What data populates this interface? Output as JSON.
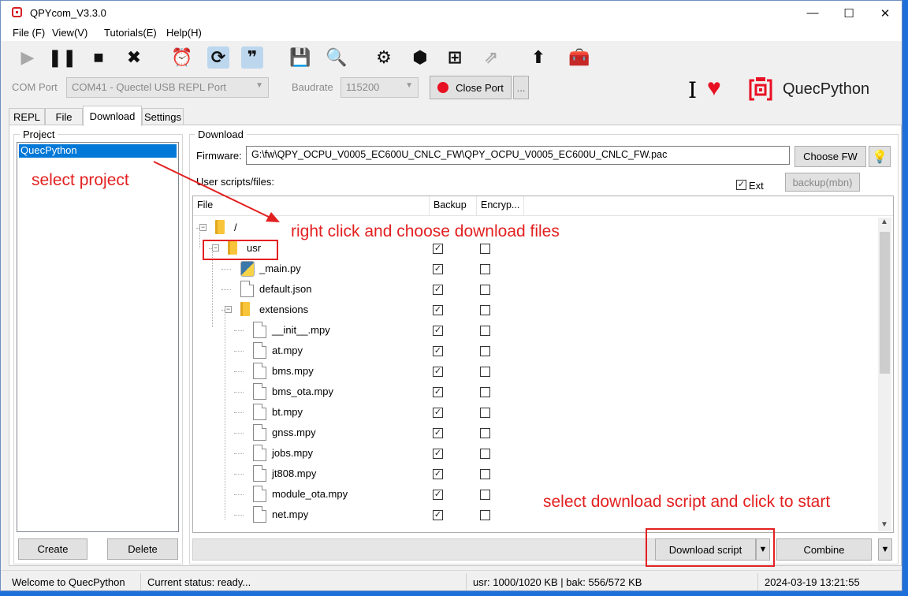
{
  "window": {
    "title": "QPYcom_V3.3.0",
    "minimize": "—",
    "maximize": "☐",
    "close": "✕"
  },
  "menu": [
    "File (F)",
    "View(V)",
    "Tutorials(E)",
    "Help(H)"
  ],
  "toolbar": [
    {
      "icon": "play-icon",
      "glyph": "▶",
      "state": "disabled"
    },
    {
      "icon": "pause-icon",
      "glyph": "❚❚",
      "state": "normal"
    },
    {
      "icon": "stop-icon",
      "glyph": "■",
      "state": "normal"
    },
    {
      "icon": "clear-icon",
      "glyph": "✖",
      "state": "normal"
    },
    {
      "icon": "timer-icon",
      "glyph": "⏰",
      "state": "normal"
    },
    {
      "icon": "repl-icon",
      "glyph": "⟳",
      "state": "active"
    },
    {
      "icon": "quote-icon",
      "glyph": "❞",
      "state": "active"
    },
    {
      "icon": "save-icon",
      "glyph": "💾",
      "state": "normal"
    },
    {
      "icon": "search-icon",
      "glyph": "🔍",
      "state": "normal"
    },
    {
      "icon": "gear-icon",
      "glyph": "⚙",
      "state": "normal"
    },
    {
      "icon": "cube-icon",
      "glyph": "⬢",
      "state": "normal"
    },
    {
      "icon": "add-icon",
      "glyph": "⊞",
      "state": "normal"
    },
    {
      "icon": "export-icon",
      "glyph": "⇗",
      "state": "disabled"
    },
    {
      "icon": "upload-icon",
      "glyph": "⬆",
      "state": "normal"
    },
    {
      "icon": "toolbox-icon",
      "glyph": "🧰",
      "state": "normal"
    }
  ],
  "com": {
    "label": "COM Port",
    "value": "COM41 - Quectel USB REPL Port",
    "baud_label": "Baudrate",
    "baud_value": "115200",
    "close_port": "Close Port",
    "more": "..."
  },
  "brand": {
    "name": "QuecPython",
    "cursor": "I",
    "heart": "♥"
  },
  "tabs": [
    "REPL",
    "File",
    "Download",
    "Settings"
  ],
  "project": {
    "title": "Project",
    "items": [
      "QuecPython"
    ],
    "create": "Create",
    "delete": "Delete"
  },
  "download": {
    "title": "Download",
    "firmware_label": "Firmware:",
    "firmware_path": "G:\\fw\\QPY_OCPU_V0005_EC600U_CNLC_FW\\QPY_OCPU_V0005_EC600U_CNLC_FW.pac",
    "choose_fw": "Choose FW",
    "user_scripts": "User scripts/files:",
    "ext_label": "Ext",
    "backup_btn": "backup(mbn)",
    "columns": [
      "File",
      "Backup",
      "Encryp..."
    ],
    "rows": [
      {
        "name": "/",
        "type": "folder",
        "level": 0,
        "backup": false,
        "encrypt": false,
        "checks": false
      },
      {
        "name": "usr",
        "type": "folder",
        "level": 1,
        "backup": true,
        "encrypt": false,
        "checks": true
      },
      {
        "name": "_main.py",
        "type": "py",
        "level": 2,
        "backup": true,
        "encrypt": false,
        "checks": true
      },
      {
        "name": "default.json",
        "type": "file",
        "level": 2,
        "backup": true,
        "encrypt": false,
        "checks": true
      },
      {
        "name": "extensions",
        "type": "folder",
        "level": 2,
        "backup": true,
        "encrypt": false,
        "checks": true
      },
      {
        "name": "__init__.mpy",
        "type": "file",
        "level": 3,
        "backup": true,
        "encrypt": false,
        "checks": true
      },
      {
        "name": "at.mpy",
        "type": "file",
        "level": 3,
        "backup": true,
        "encrypt": false,
        "checks": true
      },
      {
        "name": "bms.mpy",
        "type": "file",
        "level": 3,
        "backup": true,
        "encrypt": false,
        "checks": true
      },
      {
        "name": "bms_ota.mpy",
        "type": "file",
        "level": 3,
        "backup": true,
        "encrypt": false,
        "checks": true
      },
      {
        "name": "bt.mpy",
        "type": "file",
        "level": 3,
        "backup": true,
        "encrypt": false,
        "checks": true
      },
      {
        "name": "gnss.mpy",
        "type": "file",
        "level": 3,
        "backup": true,
        "encrypt": false,
        "checks": true
      },
      {
        "name": "jobs.mpy",
        "type": "file",
        "level": 3,
        "backup": true,
        "encrypt": false,
        "checks": true
      },
      {
        "name": "jt808.mpy",
        "type": "file",
        "level": 3,
        "backup": true,
        "encrypt": false,
        "checks": true
      },
      {
        "name": "module_ota.mpy",
        "type": "file",
        "level": 3,
        "backup": true,
        "encrypt": false,
        "checks": true
      },
      {
        "name": "net.mpy",
        "type": "file",
        "level": 3,
        "backup": true,
        "encrypt": false,
        "checks": true
      }
    ],
    "download_script": "Download script",
    "combine": "Combine",
    "dropdown": "▼"
  },
  "annotations": {
    "select_project": "select project",
    "right_click": "right click and choose download files",
    "select_download": "select download script and click to start"
  },
  "status": {
    "welcome": "Welcome to QuecPython",
    "current": "Current status: ready...",
    "usage": "usr: 1000/1020 KB | bak: 556/572 KB",
    "time": "2024-03-19 13:21:55"
  },
  "colors": {
    "accent": "#0078d7",
    "annotation": "#e32020",
    "brand_red": "#e81123"
  }
}
